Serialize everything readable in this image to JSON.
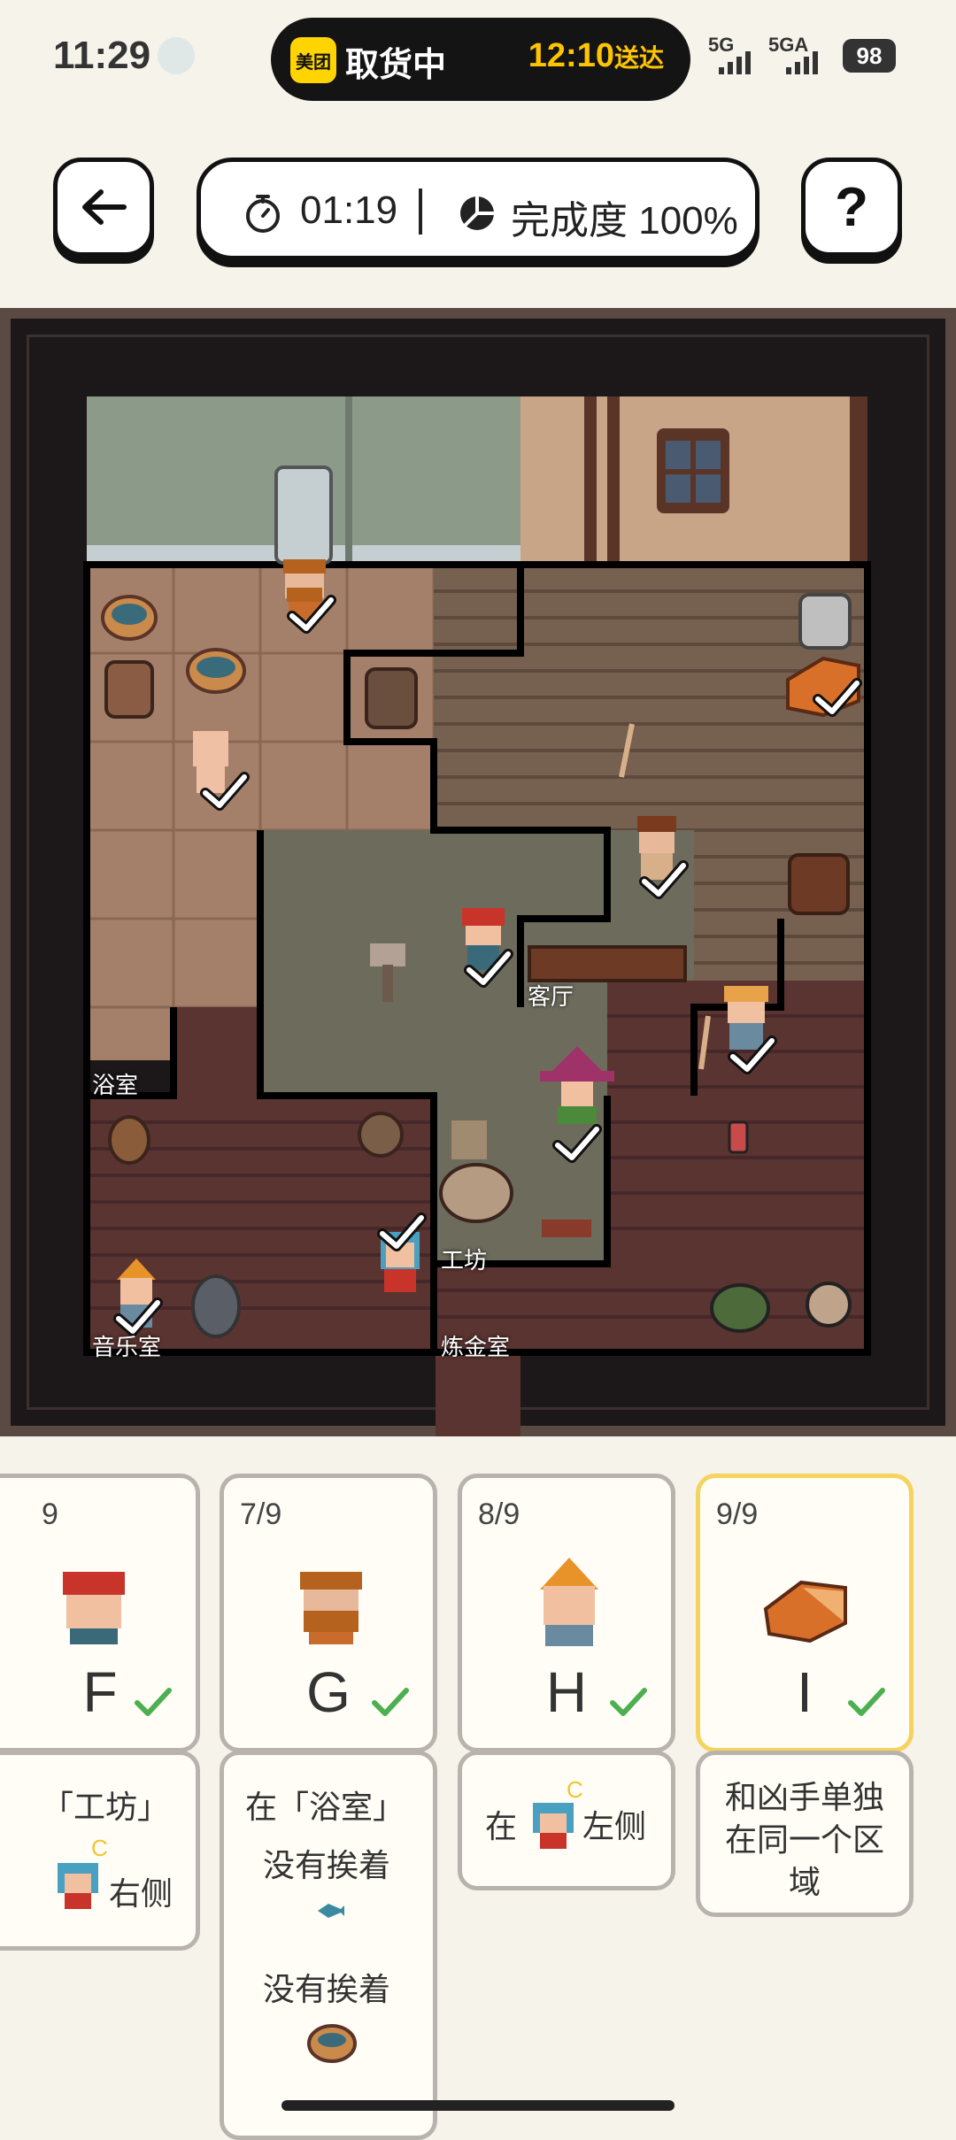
{
  "status_bar": {
    "time": "11:29",
    "island_app": "美团",
    "island_text": "取货中",
    "island_eta_time": "12:10",
    "island_eta_suffix": "送达",
    "signal_1": "5G",
    "signal_2": "5GA",
    "battery": "98"
  },
  "header": {
    "timer": "01:19",
    "progress": "完成度 100%",
    "help_label": "?"
  },
  "rooms": {
    "bath": "浴室",
    "living": "客厅",
    "workshop": "工坊",
    "music": "音乐室",
    "alchemy": "炼金室"
  },
  "cards": [
    {
      "count": "9",
      "letter": "F"
    },
    {
      "count": "7/9",
      "letter": "G"
    },
    {
      "count": "8/9",
      "letter": "H"
    },
    {
      "count": "9/9",
      "letter": "I"
    }
  ],
  "clues": {
    "f": {
      "line1": "「工坊」",
      "tag": "C",
      "line2": "右侧"
    },
    "g": {
      "line1": "在「浴室」",
      "line2": "没有挨着",
      "line3": "没有挨着"
    },
    "h": {
      "prefix": "在",
      "tag": "C",
      "suffix": "左侧"
    },
    "i": {
      "text": "和凶手单独在同一个区域"
    }
  },
  "colors": {
    "card_selected": "#f4d35e",
    "check": "#4caf50",
    "brand_yellow": "#ffd400"
  }
}
